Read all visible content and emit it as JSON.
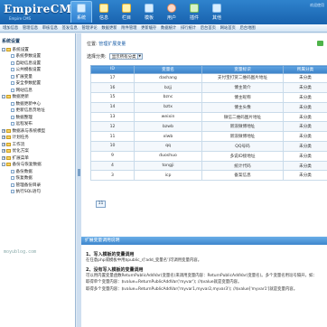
{
  "header": {
    "logo": "EmpireCMS",
    "logo_sub": "Empire CMS",
    "nav": [
      "系统",
      "信息",
      "栏目",
      "模板",
      "用户",
      "插件",
      "其他"
    ],
    "right_text": "欢迎使用"
  },
  "subnav": [
    "增加信息",
    "管理信息",
    "审核信息",
    "签发信息",
    "管理评论",
    "数据更新",
    "附件管理",
    "更新缓存",
    "数据统计",
    "排行统计",
    "后台首页",
    "网站首页",
    "后台地图"
  ],
  "sidebar": {
    "head": "系统设置",
    "tree": [
      {
        "label": "系统设置",
        "kind": "fold",
        "indent": 0,
        "tog": "-"
      },
      {
        "label": "系统参数设置",
        "kind": "doc",
        "indent": 1
      },
      {
        "label": "自助信息设置",
        "kind": "doc",
        "indent": 1
      },
      {
        "label": "公共模板设置",
        "kind": "doc",
        "indent": 1
      },
      {
        "label": "扩展变量",
        "kind": "doc",
        "indent": 1
      },
      {
        "label": "安全参数配置",
        "kind": "doc",
        "indent": 1
      },
      {
        "label": "网站信息",
        "kind": "doc",
        "indent": 1
      },
      {
        "label": "数据更新",
        "kind": "fold",
        "indent": 0,
        "tog": "-"
      },
      {
        "label": "数据更新中心",
        "kind": "doc",
        "indent": 1
      },
      {
        "label": "更新信息页地址",
        "kind": "doc",
        "indent": 1
      },
      {
        "label": "数据整理",
        "kind": "doc",
        "indent": 1
      },
      {
        "label": "远程发布",
        "kind": "doc",
        "indent": 1
      },
      {
        "label": "数据表与系统模型",
        "kind": "fold",
        "indent": 0,
        "tog": "+"
      },
      {
        "label": "计划任务",
        "kind": "fold",
        "indent": 0,
        "tog": "+"
      },
      {
        "label": "工作流",
        "kind": "fold",
        "indent": 0,
        "tog": "+"
      },
      {
        "label": "优化方案",
        "kind": "fold",
        "indent": 0,
        "tog": "+"
      },
      {
        "label": "扩展菜单",
        "kind": "fold",
        "indent": 0,
        "tog": "+"
      },
      {
        "label": "备份与恢复数据",
        "kind": "fold",
        "indent": 0,
        "tog": "-"
      },
      {
        "label": "备份数据",
        "kind": "doc",
        "indent": 1
      },
      {
        "label": "恢复数据",
        "kind": "doc",
        "indent": 1
      },
      {
        "label": "管理备份目录",
        "kind": "doc",
        "indent": 1
      },
      {
        "label": "执行SQL语句",
        "kind": "doc",
        "indent": 1
      }
    ],
    "watermark": "moyublog.com"
  },
  "main": {
    "crumb_prefix": "位置:",
    "crumb_link": "管理扩展变量",
    "filter_label": "选择分类:",
    "filter_value": "显示所有分类",
    "table": {
      "columns": [
        "ID",
        "变量名",
        "变量标识",
        "所属分类"
      ],
      "rows": [
        [
          "17",
          "dashang",
          "支付宝打赏二维码图片地址",
          "未分类"
        ],
        [
          "16",
          "bzjj",
          "博主简介",
          "未分类"
        ],
        [
          "15",
          "bznc",
          "博主昵称",
          "未分类"
        ],
        [
          "14",
          "bztx",
          "博主头像",
          "未分类"
        ],
        [
          "13",
          "weixin",
          "微信二维码图片地址",
          "未分类"
        ],
        [
          "12",
          "bzwb",
          "新浪微博地址",
          "未分类"
        ],
        [
          "11",
          "xlwb",
          "新浪微博地址",
          "未分类"
        ],
        [
          "10",
          "qq",
          "QQ号码",
          "未分类"
        ],
        [
          "9",
          "duoshuo",
          "多说ID接地址",
          "未分类"
        ],
        [
          "4",
          "tongji",
          "统计代码",
          "未分类"
        ],
        [
          "3",
          "icp",
          "备案信息",
          "未分类"
        ]
      ]
    },
    "pager": "11"
  },
  "help": {
    "title": "扩展变量调用说明",
    "h1": "1、写入模板的变量调用",
    "p1": "在任意php或模板中用$public_r['add_变量名']可调用变量内容。",
    "h2": "2、没有写入模板的变量调用",
    "p2": "可以用内置变量函数ReturnPublicAddVar(变量名)来调用变量内容：ReturnPublicAddVar(变量名)。多个变量名用逗号隔开，如：",
    "p3": "取得单个变量内容：$value=ReturnPublicAddVar('myvar'); //$value就是变量内容。",
    "p4": "取得多个变量内容：$value=ReturnPublicAddVar('myvar1,myvar2,myvar3'); //$value['myvar1']就是变量内容。"
  },
  "colors": {
    "header": "#1f6cb8",
    "table_head": "#4a90d4",
    "accent_green": "#4fb34a"
  }
}
